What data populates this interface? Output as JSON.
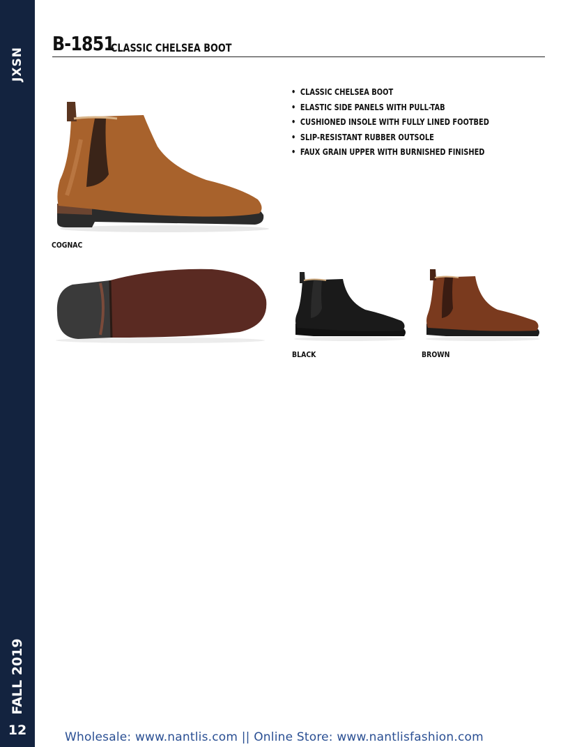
{
  "sidebar": {
    "brand": "JXSN",
    "season": "FALL 2019",
    "page_number": "12"
  },
  "header": {
    "style_number": "B-1851",
    "style_name": "CLASSIC CHELSEA BOOT"
  },
  "features": [
    "CLASSIC CHELSEA BOOT",
    "ELASTIC SIDE PANELS WITH PULL-TAB",
    "CUSHIONED INSOLE WITH FULLY LINED FOOTBED",
    "SLIP-RESISTANT RUBBER OUTSOLE",
    "FAUX GRAIN UPPER WITH BURNISHED FINISHED"
  ],
  "colors": {
    "main": {
      "label": "COGNAC",
      "hex": "#a8622c"
    },
    "black": {
      "label": "BLACK",
      "hex": "#1a1a1a"
    },
    "brown": {
      "label": "BROWN",
      "hex": "#7a3a1e"
    }
  },
  "footer": {
    "text": "Wholesale: www.nantlis.com || Online Store: www.nantlisfashion.com"
  }
}
